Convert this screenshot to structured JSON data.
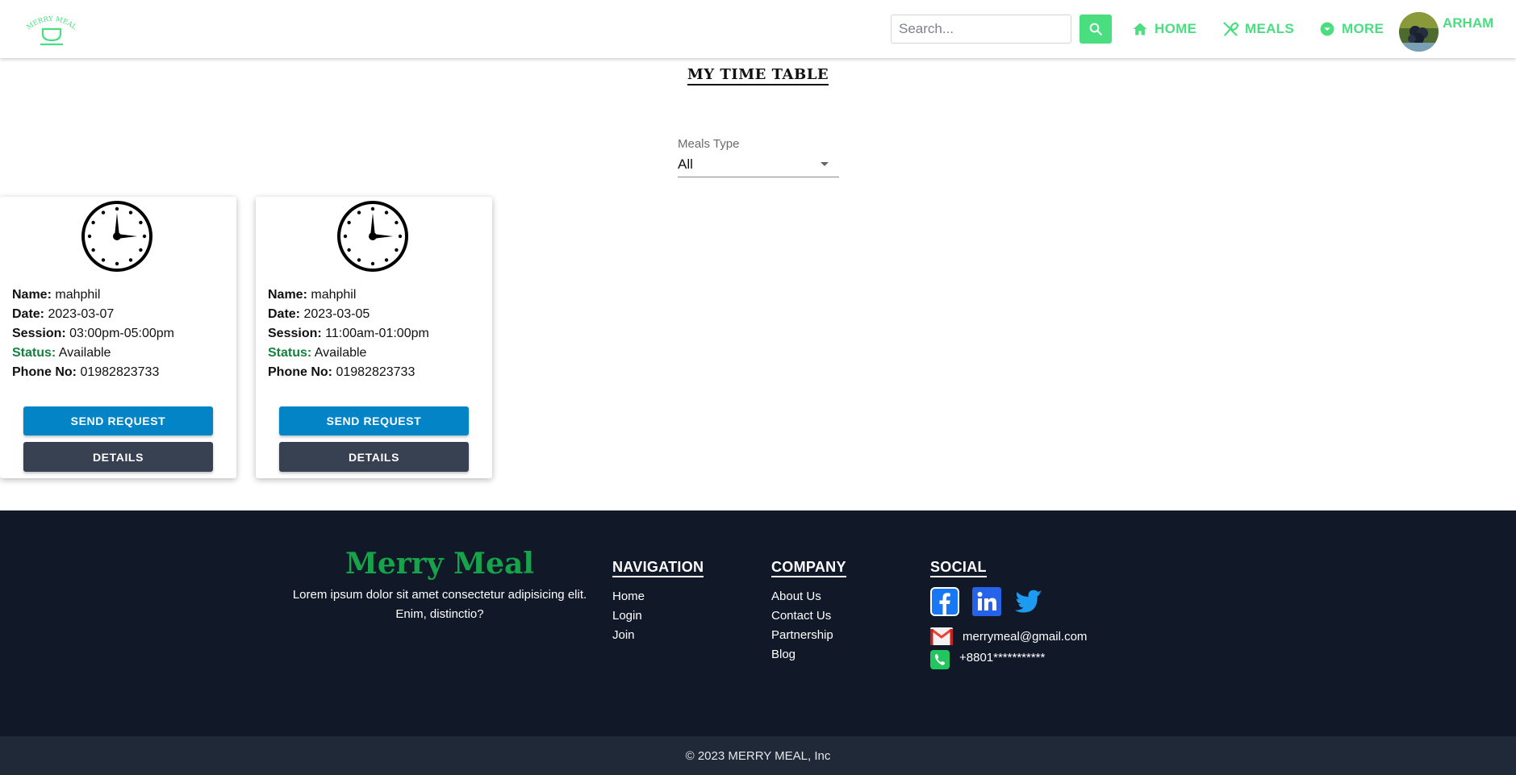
{
  "header": {
    "logo_text": "MERRY MEAL",
    "search_placeholder": "Search...",
    "nav": [
      {
        "label": "HOME",
        "icon": "home-icon"
      },
      {
        "label": "MEALS",
        "icon": "utensils-icon"
      },
      {
        "label": "MORE",
        "icon": "chevron-down-circle-icon"
      }
    ],
    "user_name": "ARHAM",
    "accent_color": "#4ade80"
  },
  "main": {
    "title": "MY TIME TABLE",
    "filter": {
      "label": "Meals Type",
      "value": "All"
    },
    "cards": [
      {
        "name_label": "Name:",
        "name": "mahphil",
        "date_label": "Date:",
        "date": "2023-03-07",
        "session_label": "Session:",
        "session": "03:00pm-05:00pm",
        "status_label": "Status:",
        "status": "Available",
        "phone_label": "Phone No:",
        "phone": "01982823733",
        "send_label": "SEND REQUEST",
        "details_label": "DETAILS"
      },
      {
        "name_label": "Name:",
        "name": "mahphil",
        "date_label": "Date:",
        "date": "2023-03-05",
        "session_label": "Session:",
        "session": "11:00am-01:00pm",
        "status_label": "Status:",
        "status": "Available",
        "phone_label": "Phone No:",
        "phone": "01982823733",
        "send_label": "SEND REQUEST",
        "details_label": "DETAILS"
      }
    ]
  },
  "footer": {
    "brand": "Merry Meal",
    "description": "Lorem ipsum dolor sit amet consectetur adipisicing elit. Enim, distinctio?",
    "navigation": {
      "title": "NAVIGATION",
      "items": [
        "Home",
        "Login",
        "Join"
      ]
    },
    "company": {
      "title": "COMPANY",
      "items": [
        "About Us",
        "Contact Us",
        "Partnership",
        "Blog"
      ]
    },
    "social": {
      "title": "SOCIAL",
      "icons": [
        "facebook-icon",
        "linkedin-icon",
        "twitter-icon"
      ],
      "email": "merrymeal@gmail.com",
      "phone": "+8801***********"
    },
    "copyright": "© 2023 MERRY MEAL, Inc"
  }
}
